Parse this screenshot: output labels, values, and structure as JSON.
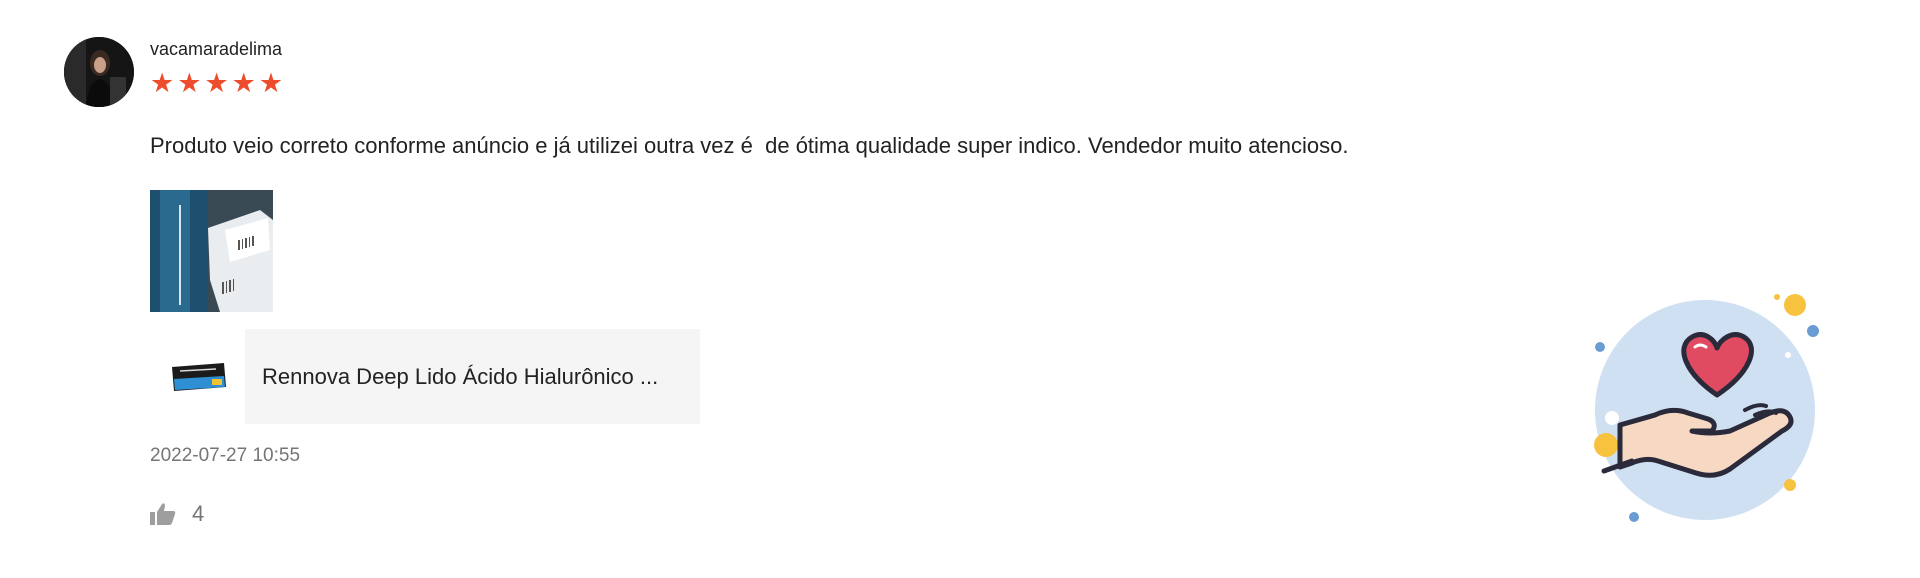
{
  "review": {
    "username": "vacamaradelima",
    "rating": 5,
    "stars": [
      "★",
      "★",
      "★",
      "★",
      "★"
    ],
    "text": "Produto veio correto conforme anúncio e já utilizei outra vez é  de ótima qualidade super indico. Vendedor muito atencioso.",
    "timestamp": "2022-07-27 10:55",
    "likes": "4"
  },
  "product": {
    "name": "Rennova Deep Lido Ácido Hialurônico ..."
  },
  "colors": {
    "star": "#ee4d2d",
    "muted_text": "#757575",
    "product_bg": "#f5f5f5"
  },
  "icons": {
    "like": "thumbs-up-icon",
    "illustration": "heart-in-hand-icon"
  }
}
